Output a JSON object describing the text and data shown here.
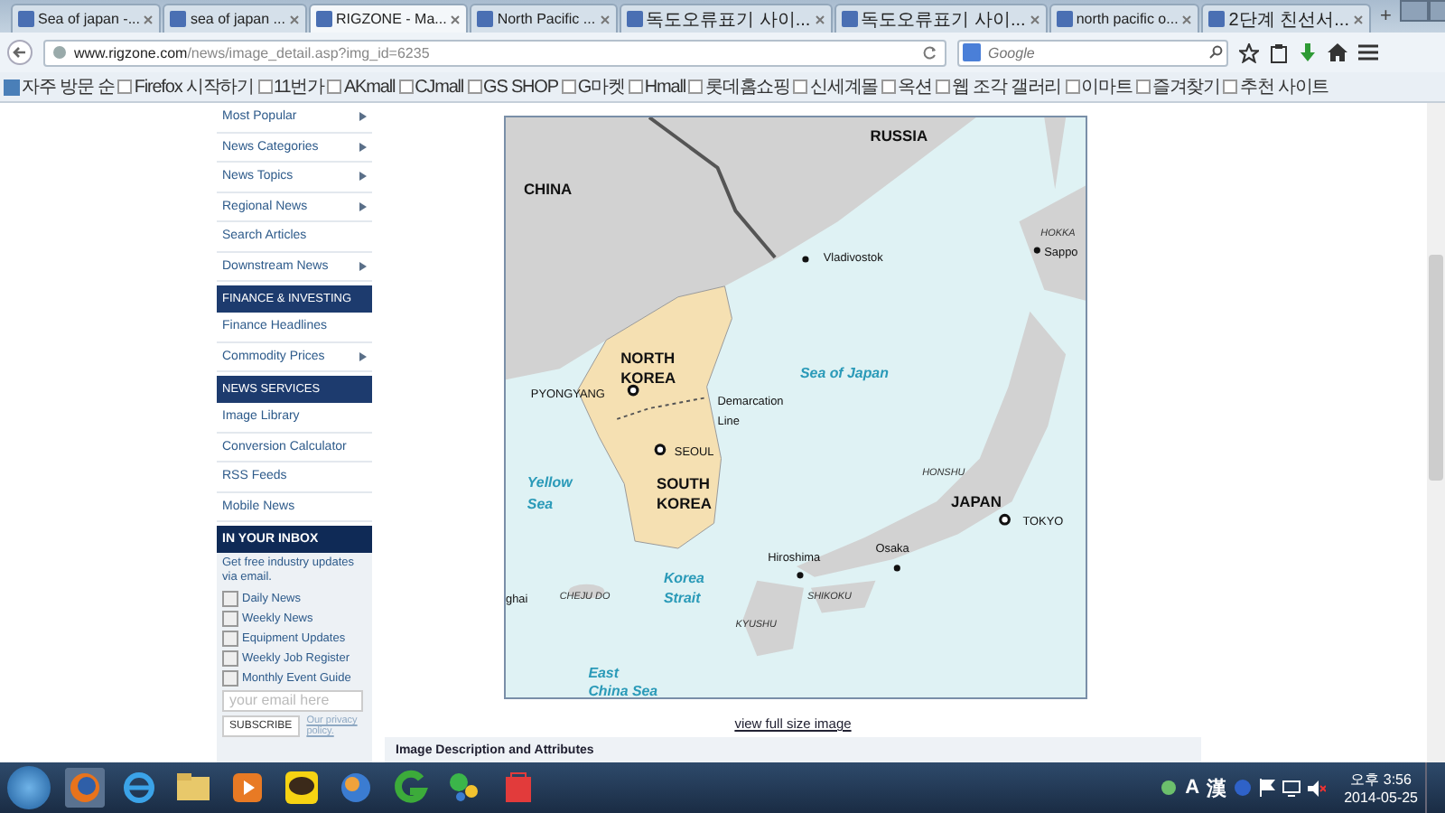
{
  "tabs": [
    {
      "title": "Sea of japan -...",
      "selected": false
    },
    {
      "title": "sea of japan ...",
      "selected": false
    },
    {
      "title": "RIGZONE - Ma...",
      "selected": true
    },
    {
      "title": "North Pacific ...",
      "selected": false
    },
    {
      "title": "독도오류표기 사이...",
      "selected": false
    },
    {
      "title": "독도오류표기 사이...",
      "selected": false
    },
    {
      "title": "north pacific o...",
      "selected": false
    },
    {
      "title": "2단계 친선서...",
      "selected": false
    }
  ],
  "new_tab": "+",
  "address_bar": {
    "url_host": "www.rigzone.com",
    "url_path": "/news/image_detail.asp?img_id=6235"
  },
  "search": {
    "placeholder": "Google"
  },
  "bookmarks": [
    "자주 방문 순",
    "Firefox 시작하기",
    "11번가",
    "AKmall",
    "CJmall",
    "GS SHOP",
    "G마켓",
    "Hmall",
    "롯데홈쇼핑",
    "신세계몰",
    "옥션",
    "웹 조각 갤러리",
    "이마트",
    "즐겨찾기",
    "추천 사이트"
  ],
  "sidebar": {
    "sections": [
      {
        "items": [
          {
            "label": "Most Popular",
            "has_submenu": true
          },
          {
            "label": "News Categories",
            "has_submenu": true
          },
          {
            "label": "News Topics",
            "has_submenu": true
          },
          {
            "label": "Regional News",
            "has_submenu": true
          },
          {
            "label": "Search Articles",
            "has_submenu": false
          },
          {
            "label": "Downstream News",
            "has_submenu": true
          }
        ]
      },
      {
        "heading": "FINANCE & INVESTING",
        "items": [
          {
            "label": "Finance Headlines",
            "has_submenu": false
          },
          {
            "label": "Commodity Prices",
            "has_submenu": true
          }
        ]
      },
      {
        "heading": "NEWS SERVICES",
        "items": [
          {
            "label": "Image Library",
            "has_submenu": false
          },
          {
            "label": "Conversion Calculator",
            "has_submenu": false
          },
          {
            "label": "RSS Feeds",
            "has_submenu": false
          },
          {
            "label": "Mobile News",
            "has_submenu": false
          }
        ]
      }
    ],
    "inbox": {
      "heading": "IN YOUR INBOX",
      "intro": "Get free industry updates via email.",
      "options": [
        {
          "label": "Daily News",
          "checked": false
        },
        {
          "label": "Weekly News",
          "checked": false
        },
        {
          "label": "Equipment Updates",
          "checked": false
        },
        {
          "label": "Weekly Job Register",
          "checked": false
        },
        {
          "label": "Monthly Event Guide",
          "checked": false
        }
      ],
      "email_placeholder": "your email here",
      "subscribe": "SUBSCRIBE",
      "privacy_link": "Our privacy policy."
    }
  },
  "map": {
    "labels": [
      {
        "text": "RUSSIA",
        "kind": "country"
      },
      {
        "text": "CHINA",
        "kind": "country"
      },
      {
        "text": "HOKKA",
        "kind": "region"
      },
      {
        "text": "Sappo",
        "kind": "city"
      },
      {
        "text": "Vladivostok",
        "kind": "city"
      },
      {
        "text": "NORTH KOREA",
        "kind": "country"
      },
      {
        "text": "Sea of Japan",
        "kind": "sea"
      },
      {
        "text": "PYONGYANG",
        "kind": "capital"
      },
      {
        "text": "Demarcation Line",
        "kind": "note"
      },
      {
        "text": "SEOUL",
        "kind": "capital"
      },
      {
        "text": "HONSHU",
        "kind": "region"
      },
      {
        "text": "Yellow Sea",
        "kind": "sea"
      },
      {
        "text": "SOUTH KOREA",
        "kind": "country"
      },
      {
        "text": "JAPAN",
        "kind": "country"
      },
      {
        "text": "TOKYO",
        "kind": "capital"
      },
      {
        "text": "Osaka",
        "kind": "city"
      },
      {
        "text": "Hiroshima",
        "kind": "city"
      },
      {
        "text": "ghai",
        "kind": "note"
      },
      {
        "text": "CHEJU DO",
        "kind": "region"
      },
      {
        "text": "Korea Strait",
        "kind": "sea"
      },
      {
        "text": "SHIKOKU",
        "kind": "region"
      },
      {
        "text": "KYUSHU",
        "kind": "region"
      },
      {
        "text": "East China Sea",
        "kind": "sea"
      }
    ]
  },
  "view_full_size": "view full size image",
  "description_heading": "Image Description and Attributes",
  "taskbar": {
    "tray_chars": [
      "A",
      "漢"
    ],
    "time": "오후 3:56",
    "date": "2014-05-25"
  }
}
